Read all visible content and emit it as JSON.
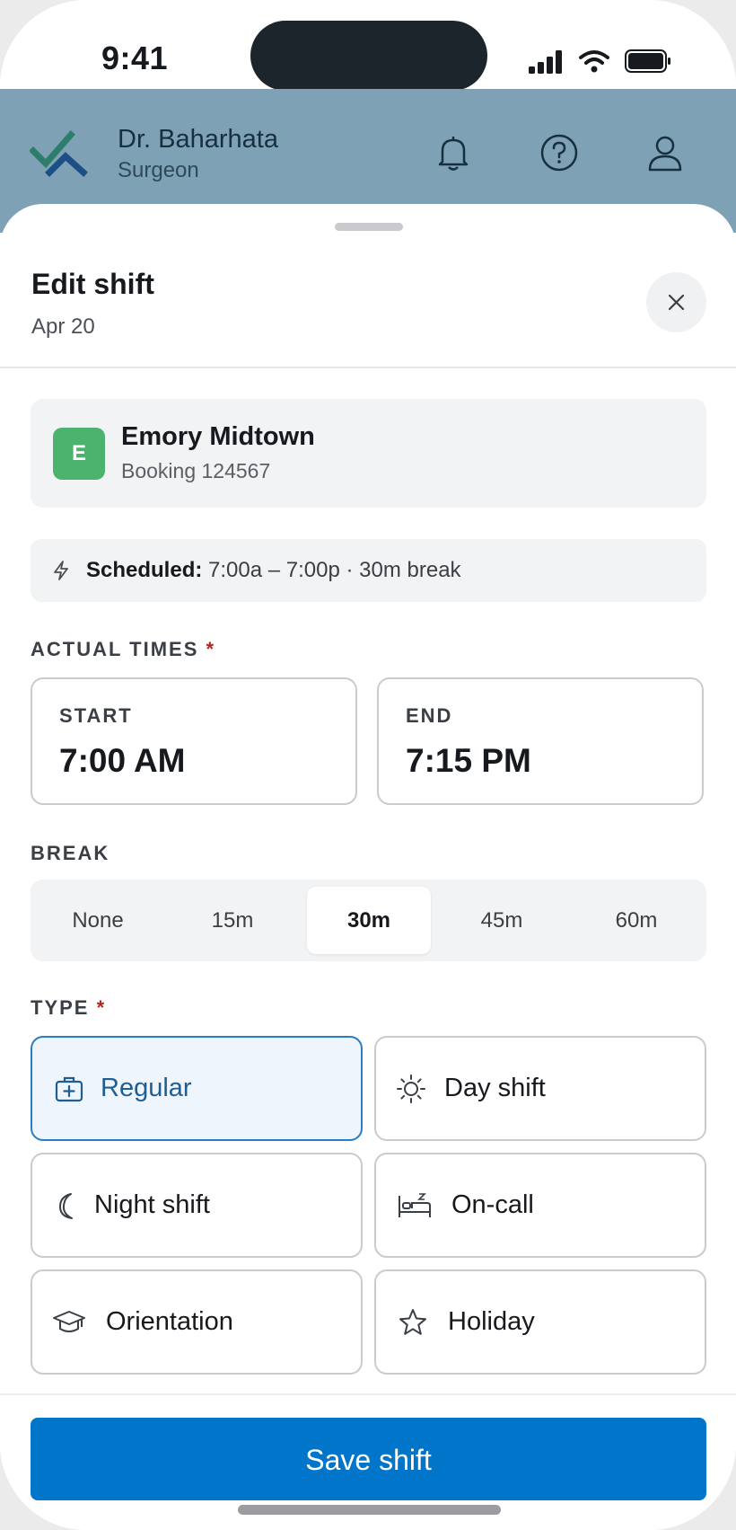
{
  "status": {
    "time": "9:41"
  },
  "header": {
    "name": "Dr. Baharhata",
    "role": "Surgeon"
  },
  "sheet": {
    "title": "Edit shift",
    "date": "Apr 20"
  },
  "facility": {
    "initial": "E",
    "name": "Emory Midtown",
    "booking": "Booking 124567"
  },
  "scheduled": {
    "label": "Scheduled:",
    "detail": " 7:00a – 7:00p · 30m break"
  },
  "actual_times": {
    "label": "ACTUAL TIMES",
    "required": "*",
    "start_label": "START",
    "start_value": "7:00 AM",
    "end_label": "END",
    "end_value": "7:15 PM"
  },
  "break": {
    "label": "BREAK",
    "options": [
      "None",
      "15m",
      "30m",
      "45m",
      "60m"
    ],
    "selected": "30m"
  },
  "type": {
    "label": "TYPE",
    "required": "*",
    "options": [
      {
        "label": "Regular",
        "icon": "medical-bag-icon",
        "selected": true
      },
      {
        "label": "Day shift",
        "icon": "sun-icon",
        "selected": false
      },
      {
        "label": "Night shift",
        "icon": "moon-icon",
        "selected": false
      },
      {
        "label": "On-call",
        "icon": "bed-icon",
        "selected": false
      },
      {
        "label": "Orientation",
        "icon": "graduation-cap-icon",
        "selected": false
      },
      {
        "label": "Holiday",
        "icon": "star-icon",
        "selected": false
      }
    ]
  },
  "footer": {
    "save_label": "Save shift"
  },
  "colors": {
    "accent": "#0075c9",
    "header_bg": "#7ea1b5",
    "badge_green": "#4bb36e",
    "required": "#b3261e",
    "selected_bg": "#eef5fc"
  }
}
